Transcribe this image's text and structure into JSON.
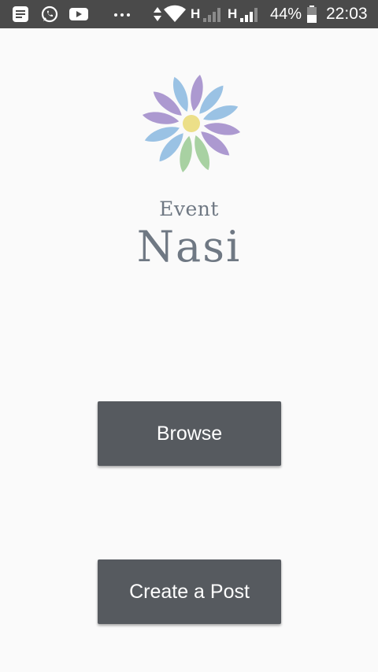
{
  "status_bar": {
    "left_icons": [
      "message-icon",
      "whatsapp-icon",
      "youtube-icon",
      "more-notifications-icon"
    ],
    "network_1": "H",
    "network_2": "H",
    "battery_percent": "44%",
    "time": "22:03"
  },
  "logo": {
    "line1": "Event",
    "line2": "Nasi",
    "petal_colors": [
      "#a894cd",
      "#95bfe3",
      "#a3cf9d",
      "#ecdf88"
    ]
  },
  "actions": {
    "browse_label": "Browse",
    "create_label": "Create a Post"
  }
}
